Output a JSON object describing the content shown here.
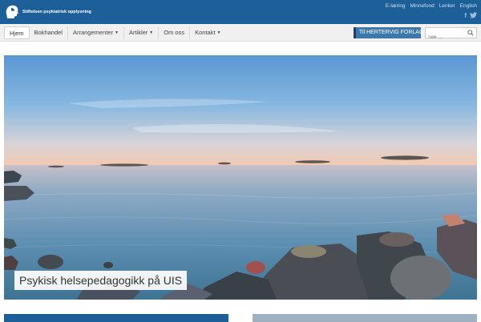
{
  "header": {
    "logo_text": "Stiftelsen psykiatrisk opplysning",
    "top_links": [
      "E-læring",
      "Minnefond",
      "Lenker",
      "English"
    ],
    "social_icons": [
      "facebook-icon",
      "twitter-icon"
    ]
  },
  "nav": {
    "items": [
      {
        "label": "Hjem",
        "active": true,
        "dropdown": false
      },
      {
        "label": "Bokhandel",
        "active": false,
        "dropdown": false
      },
      {
        "label": "Arrangementer",
        "active": false,
        "dropdown": true
      },
      {
        "label": "Artikler",
        "active": false,
        "dropdown": true
      },
      {
        "label": "Om oss",
        "active": false,
        "dropdown": false
      },
      {
        "label": "Kontakt",
        "active": false,
        "dropdown": true
      }
    ],
    "forlag_label": "Til HERTERVIG FORLAG",
    "search_placeholder": "Søk ..."
  },
  "hero": {
    "caption": "Psykisk helsepedagogikk på UIS"
  },
  "colors": {
    "brand_blue": "#1d5f99",
    "nav_bg": "#f0f0f0",
    "forlag_blue": "#3c78aa"
  }
}
